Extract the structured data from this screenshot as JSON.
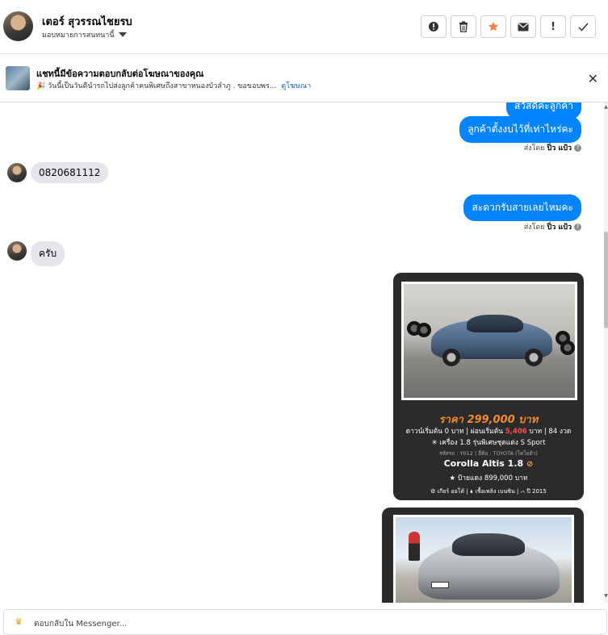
{
  "header": {
    "name": "เตอร์ สุวรรณไชยรบ",
    "assignee": "มอบหมายการสนทนานี้",
    "actions": [
      {
        "icon": "alert-circle-icon",
        "glyph": "!"
      },
      {
        "icon": "trash-icon",
        "glyph": "🗑"
      },
      {
        "icon": "star-icon",
        "glyph": "★"
      },
      {
        "icon": "envelope-icon",
        "glyph": "✉"
      },
      {
        "icon": "exclamation-icon",
        "glyph": "!"
      },
      {
        "icon": "check-icon",
        "glyph": "✓"
      }
    ]
  },
  "ad": {
    "title": "แชทนี้มีข้อความตอบกลับต่อโฆษณาของคุณ",
    "desc": "🎉 วันนี้เป็นวันดีนำรถไปส่งลูกค้าคนพิเศษถึงสาขาหนองบัวลำภู . ขอขอบพร...",
    "link": "ดูโฆษณา"
  },
  "messages": {
    "partial_top": "สวัสดีค่ะลูกค้า",
    "out1": "ลูกค้าตั้งงบไว้ที่เท่าไหร่คะ",
    "sent_label": "ส่งโดย",
    "sender": "ปิ่ว แป้ว",
    "in1": "0820681112",
    "out2": "สะดวกรับสายเลยไหมคะ",
    "in2": "ครับ"
  },
  "card1": {
    "price": "ราคา 299,000 บาท",
    "line1_a": "ดาวน์เริ่มต้น 0 บาท | ผ่อนเริ่มต้น ",
    "line1_red": "5,406",
    "line1_b": " บาท | 84 งวด",
    "line2": "✳ เครื่อง 1.8 รุ่นพิเศษชุดแต่ง S Sport",
    "line3": "รหัสรถ : Y012 | ยี่ห้อ : TOYOTA (โตโยต้า)",
    "model": "Corolla Altis 1.8",
    "plate": "★ ป้ายแดง 899,000 บาท",
    "footer": "⚙ เกียร์ ออโต้   |   🌢 เชื้อเพลิง เบนซิน   |   ⌒ ปี 2015"
  },
  "reply": {
    "placeholder": "ตอบกลับใน Messenger..."
  },
  "colors": {
    "messenger_blue": "#0084ff",
    "incoming_gray": "#e4e6eb",
    "price_orange": "#f58a2a"
  }
}
